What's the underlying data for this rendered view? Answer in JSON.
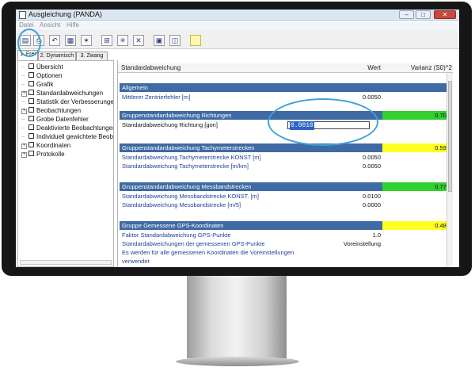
{
  "window": {
    "title": "Ausgleichung (PANDA)",
    "controls": {
      "minimize": "–",
      "maximize": "□",
      "close": "✕"
    }
  },
  "menu": [
    "Datei",
    "Ansicht",
    "Hilfe"
  ],
  "toolbar_icons": [
    "page-icon",
    "print-icon",
    "undo-icon",
    "calculator-icon",
    "network-icon",
    "table-icon",
    "network-select-icon",
    "network-cross-icon",
    "window-icon",
    "window-split-icon",
    "note-icon"
  ],
  "tabs": [
    "1. Frei",
    "2. Dynamisch",
    "3. Zwang"
  ],
  "tree": [
    {
      "label": "Übersicht",
      "expand": false
    },
    {
      "label": "Optionen",
      "expand": false
    },
    {
      "label": "Grafik",
      "expand": false
    },
    {
      "label": "Standardabweichungen",
      "expand": true
    },
    {
      "label": "Statistik der Verbesserungen",
      "expand": false
    },
    {
      "label": "Beobachtungen",
      "expand": true
    },
    {
      "label": "Grobe Datenfehler",
      "expand": false
    },
    {
      "label": "Deaktivierte Beobachtungen",
      "expand": false
    },
    {
      "label": "Individuell gewichtete Beob",
      "expand": false
    },
    {
      "label": "Koordinaten",
      "expand": true
    },
    {
      "label": "Protokolle",
      "expand": true
    }
  ],
  "grid": {
    "headers": {
      "name": "Standardabweichung",
      "value": "Wert",
      "variance": "Varianz (S0)^2"
    },
    "rows": [
      {
        "type": "section",
        "label": "Allgemein",
        "variance": ""
      },
      {
        "type": "data",
        "label": "Mittlerer Zentrierfehler [m]",
        "value": "0.0050"
      },
      {
        "type": "section",
        "label": "Gruppenstandardabweichung Richtungen",
        "variance": "0.708"
      },
      {
        "type": "input",
        "label": "Standardabweichung Richtung [gon]",
        "value": "0.0010"
      },
      {
        "type": "section",
        "label": "Gruppenstandardabweichung Tachymeterstrecken",
        "variance": "0.593"
      },
      {
        "type": "data",
        "label": "Standardabweichung Tachymeterstrecke KONST [m]",
        "value": "0.0050"
      },
      {
        "type": "data",
        "label": "Standardabweichung Tachymeterstrecke [m/km]",
        "value": "0.0050"
      },
      {
        "type": "section",
        "label": "Gruppenstandardabweichung Messbandstrecken",
        "variance": "0.773"
      },
      {
        "type": "data",
        "label": "Standardabweichung Messbandstrecke KONST. [m]",
        "value": "0.0100"
      },
      {
        "type": "data",
        "label": "Standardabweichung Messbandstrecke [m/5]",
        "value": "0.0000"
      },
      {
        "type": "section",
        "label": "Gruppe Gemessene GPS-Koordinaten",
        "variance": "0.488"
      },
      {
        "type": "data",
        "label": "Faktor Standardabweichung GPS-Punkte",
        "value": "1.0"
      },
      {
        "type": "data",
        "label": "Standardabweichungen der gemessenen GPS-Punkte",
        "value": "Voreinstellung"
      },
      {
        "type": "data",
        "label": "Es werden für alle gemessenen Koordinaten die Voreinstellungen",
        "value": ""
      },
      {
        "type": "data",
        "label": "verwendet",
        "value": ""
      }
    ]
  },
  "colors": {
    "section_bg": "#3f6aa3",
    "good": "#2fd02f",
    "warn": "#ffff22",
    "annotation": "#3fa2d6"
  }
}
